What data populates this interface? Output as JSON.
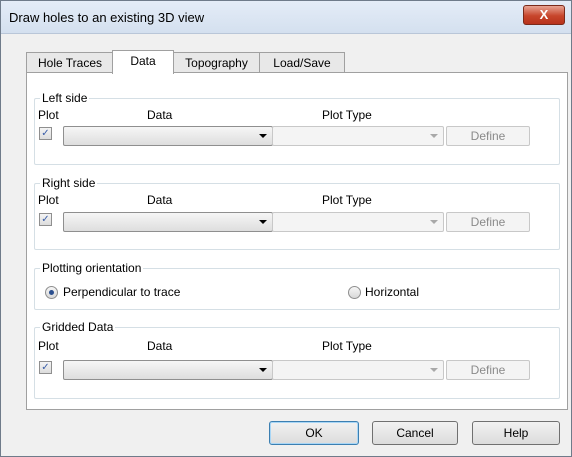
{
  "window": {
    "title": "Draw holes to an existing 3D view",
    "close_label": "X"
  },
  "tabs": [
    "Hole Traces",
    "Data",
    "Topography",
    "Load/Save"
  ],
  "active_tab": "Data",
  "left_side": {
    "legend": "Left side",
    "plot_label": "Plot",
    "data_label": "Data",
    "plot_type_label": "Plot Type",
    "plot_checked": true,
    "data_value": "",
    "plot_type_value": "",
    "define_label": "Define"
  },
  "right_side": {
    "legend": "Right side",
    "plot_label": "Plot",
    "data_label": "Data",
    "plot_type_label": "Plot Type",
    "plot_checked": true,
    "data_value": "",
    "plot_type_value": "",
    "define_label": "Define"
  },
  "orientation": {
    "legend": "Plotting orientation",
    "options": [
      "Perpendicular to trace",
      "Horizontal"
    ],
    "selected": "Perpendicular to trace"
  },
  "gridded_data": {
    "legend": "Gridded Data",
    "plot_label": "Plot",
    "data_label": "Data",
    "plot_type_label": "Plot Type",
    "plot_checked": true,
    "data_value": "",
    "plot_type_value": "",
    "define_label": "Define"
  },
  "buttons": {
    "ok": "OK",
    "cancel": "Cancel",
    "help": "Help"
  },
  "colors": {
    "close_button": "#c7452b",
    "checkmark": "#3a5ea8"
  }
}
